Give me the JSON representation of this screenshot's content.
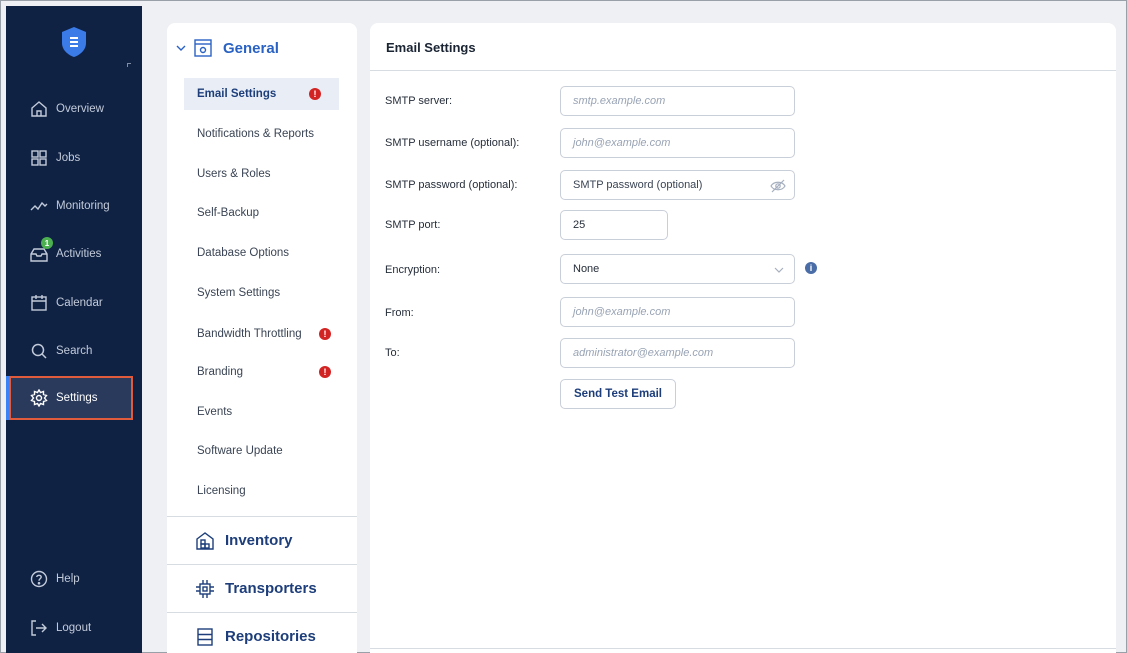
{
  "nav": {
    "items": [
      {
        "label": "Overview",
        "icon": "home-icon"
      },
      {
        "label": "Jobs",
        "icon": "grid-icon"
      },
      {
        "label": "Monitoring",
        "icon": "pulse-icon"
      },
      {
        "label": "Activities",
        "icon": "tray-icon",
        "badge": "1"
      },
      {
        "label": "Calendar",
        "icon": "calendar-icon"
      },
      {
        "label": "Search",
        "icon": "search-icon"
      },
      {
        "label": "Settings",
        "icon": "gear-icon"
      },
      {
        "label": "Help",
        "icon": "help-icon"
      },
      {
        "label": "Logout",
        "icon": "logout-icon"
      }
    ],
    "active": "Settings"
  },
  "submenu": {
    "general_title": "General",
    "items": [
      {
        "label": "Email Settings",
        "warning": true
      },
      {
        "label": "Notifications & Reports"
      },
      {
        "label": "Users & Roles"
      },
      {
        "label": "Self-Backup"
      },
      {
        "label": "Database Options"
      },
      {
        "label": "System Settings"
      },
      {
        "label": "Bandwidth Throttling",
        "warning": true
      },
      {
        "label": "Branding",
        "warning": true
      },
      {
        "label": "Events"
      },
      {
        "label": "Software Update"
      },
      {
        "label": "Licensing"
      }
    ],
    "warning_mark": "!",
    "groups": [
      {
        "label": "Inventory",
        "icon": "inventory-icon"
      },
      {
        "label": "Transporters",
        "icon": "chip-icon"
      },
      {
        "label": "Repositories",
        "icon": "storage-icon"
      }
    ]
  },
  "panel": {
    "title": "Email Settings",
    "fields": {
      "smtp_server": {
        "label": "SMTP server:",
        "placeholder": "smtp.example.com"
      },
      "smtp_username": {
        "label": "SMTP username (optional):",
        "placeholder": "john@example.com"
      },
      "smtp_password": {
        "label": "SMTP password (optional):",
        "placeholder": "SMTP password (optional)"
      },
      "smtp_port": {
        "label": "SMTP port:",
        "value": "25"
      },
      "encryption": {
        "label": "Encryption:",
        "value": "None"
      },
      "from": {
        "label": "From:",
        "placeholder": "john@example.com"
      },
      "to": {
        "label": "To:",
        "placeholder": "administrator@example.com"
      }
    },
    "info_mark": "i",
    "send_test_label": "Send Test Email"
  },
  "colors": {
    "nav_bg": "#0f2244",
    "accent": "#2a62c4",
    "warning": "#d32424",
    "badge": "#4caf50",
    "active_outline": "#e05a3c"
  }
}
